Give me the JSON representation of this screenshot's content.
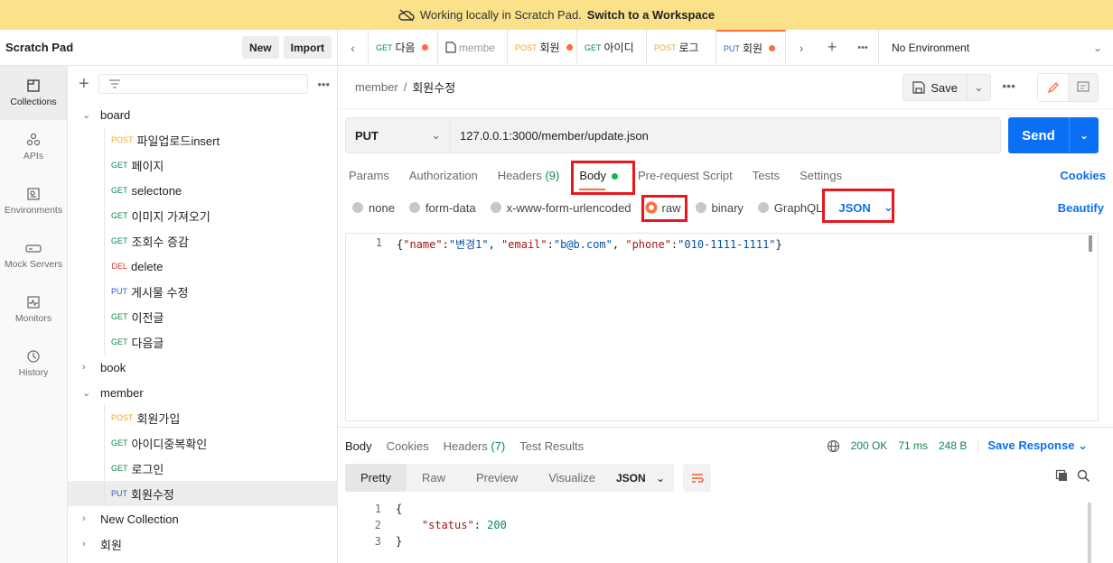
{
  "banner": {
    "text": "Working locally in Scratch Pad.",
    "link": "Switch to a Workspace"
  },
  "sidebar": {
    "title": "Scratch Pad",
    "new_label": "New",
    "import_label": "Import",
    "rail": [
      {
        "label": "Collections",
        "icon": "collections-icon"
      },
      {
        "label": "APIs",
        "icon": "apis-icon"
      },
      {
        "label": "Environments",
        "icon": "environments-icon"
      },
      {
        "label": "Mock Servers",
        "icon": "mock-servers-icon"
      },
      {
        "label": "Monitors",
        "icon": "monitors-icon"
      },
      {
        "label": "History",
        "icon": "history-icon"
      }
    ],
    "tree": {
      "board": {
        "name": "board",
        "items": [
          {
            "method": "POST",
            "name": "파일업로드insert"
          },
          {
            "method": "GET",
            "name": "페이지"
          },
          {
            "method": "GET",
            "name": "selectone"
          },
          {
            "method": "GET",
            "name": "이미지 가져오기"
          },
          {
            "method": "GET",
            "name": "조회수 증감"
          },
          {
            "method": "DEL",
            "name": "delete"
          },
          {
            "method": "PUT",
            "name": "게시물 수정"
          },
          {
            "method": "GET",
            "name": "이전글"
          },
          {
            "method": "GET",
            "name": "다음글"
          }
        ]
      },
      "book": {
        "name": "book"
      },
      "member": {
        "name": "member",
        "items": [
          {
            "method": "POST",
            "name": "회원가입"
          },
          {
            "method": "GET",
            "name": "아이디중복확인"
          },
          {
            "method": "GET",
            "name": "로그인"
          },
          {
            "method": "PUT",
            "name": "회원수정"
          }
        ]
      },
      "new_collection": {
        "name": "New Collection"
      },
      "member_ko": {
        "name": "회원"
      }
    }
  },
  "tabs": [
    {
      "method": "GET",
      "name": "다음"
    },
    {
      "method": "",
      "name": "membe"
    },
    {
      "method": "POST",
      "name": "회원"
    },
    {
      "method": "GET",
      "name": "아이디"
    },
    {
      "method": "POST",
      "name": "로그"
    },
    {
      "method": "PUT",
      "name": "회원"
    }
  ],
  "environment": "No Environment",
  "breadcrumb": {
    "collection": "member",
    "sep": "/",
    "request": "회원수정"
  },
  "save_label": "Save",
  "request": {
    "method": "PUT",
    "url": "127.0.0.1:3000/member/update.json",
    "send_label": "Send"
  },
  "req_tabs": {
    "params": "Params",
    "authorization": "Authorization",
    "headers": "Headers",
    "headers_count": "(9)",
    "body": "Body",
    "prerequest": "Pre-request Script",
    "tests": "Tests",
    "settings": "Settings",
    "cookies": "Cookies"
  },
  "body_types": {
    "none": "none",
    "form_data": "form-data",
    "urlencoded": "x-www-form-urlencoded",
    "raw": "raw",
    "binary": "binary",
    "graphql": "GraphQL",
    "format": "JSON",
    "beautify": "Beautify"
  },
  "editor": {
    "line1_no": "1",
    "body": [
      {
        "t": "p",
        "v": "{"
      },
      {
        "t": "k",
        "v": "\"name\""
      },
      {
        "t": "p",
        "v": ":"
      },
      {
        "t": "v",
        "v": "\"변경1\""
      },
      {
        "t": "p",
        "v": ", "
      },
      {
        "t": "k",
        "v": "\"email\""
      },
      {
        "t": "p",
        "v": ":"
      },
      {
        "t": "v",
        "v": "\"b@b.com\""
      },
      {
        "t": "p",
        "v": ", "
      },
      {
        "t": "k",
        "v": "\"phone\""
      },
      {
        "t": "p",
        "v": ":"
      },
      {
        "t": "v",
        "v": "\"010-1111-1111\""
      },
      {
        "t": "p",
        "v": "}"
      }
    ]
  },
  "response": {
    "tabs": {
      "body": "Body",
      "cookies": "Cookies",
      "headers": "Headers",
      "headers_count": "(7)",
      "tests": "Test Results"
    },
    "status": "200 OK",
    "time": "71 ms",
    "size": "248 B",
    "save": "Save Response",
    "view_tabs": {
      "pretty": "Pretty",
      "raw": "Raw",
      "preview": "Preview",
      "visualize": "Visualize"
    },
    "format": "JSON",
    "lines": [
      {
        "no": "1",
        "text": "{"
      },
      {
        "no": "2",
        "key": "\"status\"",
        "val": "200"
      },
      {
        "no": "3",
        "text": "}"
      }
    ]
  },
  "colors": {
    "accent": "#ff6c37",
    "primary": "#0b6ff4",
    "banner": "#fbe18a",
    "highlight": "#e8181e"
  }
}
